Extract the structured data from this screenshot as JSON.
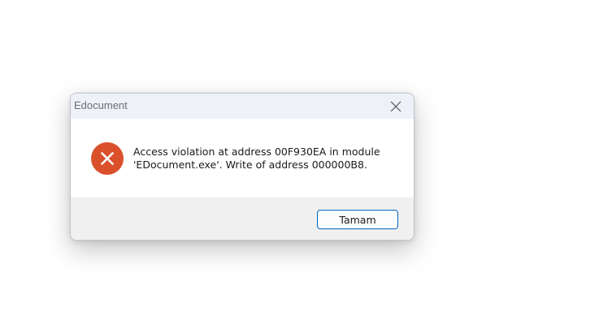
{
  "dialog": {
    "title": "Edocument",
    "close_icon": "close-icon",
    "status_icon": "error-icon",
    "message_lines": [
      "Access violation at address 00F930EA in module",
      "'EDocument.exe'. Write of address 000000B8."
    ],
    "ok_button_label": "Tamam"
  },
  "colors": {
    "titlebar_bg": "#eef1f8",
    "footer_bg": "#f0f0f0",
    "error_icon": "#d9502b",
    "button_border": "#0067c0"
  }
}
